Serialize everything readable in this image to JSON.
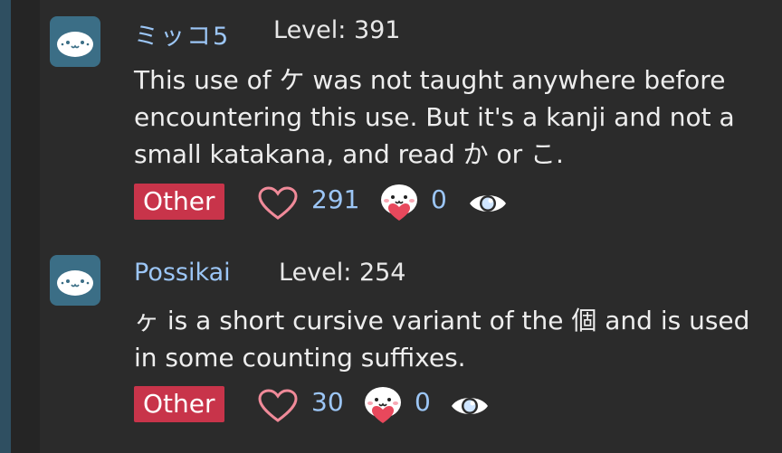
{
  "posts": [
    {
      "username": "ミッコ5",
      "level": "Level: 391",
      "body": "This use of ケ was not taught anywhere before encountering this use. But it's a kanji and not a small katakana, and read か or こ.",
      "tag": "Other",
      "likes": "291",
      "loves": "0"
    },
    {
      "username": "Possikai",
      "level": "Level: 254",
      "body": "ヶ is a short cursive variant of the 個 and is used in some counting suffixes.",
      "tag": "Other",
      "likes": "30",
      "loves": "0"
    }
  ],
  "colors": {
    "accent": "#9cc6f6",
    "tag": "#c8344a",
    "background": "#2b2b2b",
    "avatar": "#3b6e86"
  },
  "icons": [
    "avatar-face-icon",
    "heart-outline-icon",
    "smiley-heart-icon",
    "eye-icon"
  ]
}
